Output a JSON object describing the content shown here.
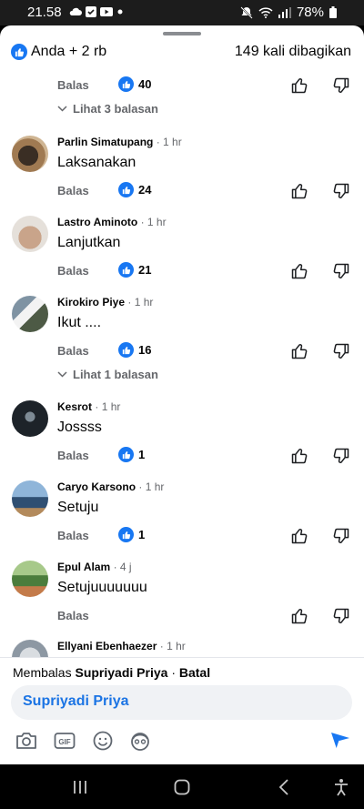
{
  "status_bar": {
    "time": "21.58",
    "battery": "78%"
  },
  "header": {
    "reactions": "Anda + 2 rb",
    "shares": "149 kali dibagikan"
  },
  "top_actions": {
    "reply_label": "Balas",
    "like_count": "40",
    "view_replies": "Lihat 3 balasan"
  },
  "comments": [
    {
      "author": "Parlin Simatupang",
      "time": "1 hr",
      "text": "Laksanakan",
      "reply_label": "Balas",
      "like_count": "24"
    },
    {
      "author": "Lastro Aminoto",
      "time": "1 hr",
      "text": "Lanjutkan",
      "reply_label": "Balas",
      "like_count": "21"
    },
    {
      "author": "Kirokiro Piye",
      "time": "1 hr",
      "text": "Ikut ....",
      "reply_label": "Balas",
      "like_count": "16",
      "view_replies": "Lihat 1 balasan"
    },
    {
      "author": "Kesrot",
      "time": "1 hr",
      "text": "Jossss",
      "reply_label": "Balas",
      "like_count": "1"
    },
    {
      "author": "Caryo Karsono",
      "time": "1 hr",
      "text": "Setuju",
      "reply_label": "Balas",
      "like_count": "1"
    },
    {
      "author": "Epul Alam",
      "time": "4 j",
      "text": "Setujuuuuuuu",
      "reply_label": "Balas",
      "like_count": ""
    },
    {
      "author": "Ellyani Ebenhaezer",
      "time": "1 hr",
      "text": ""
    }
  ],
  "reply_bar": {
    "prefix": "Membalas",
    "target": "Supriyadi Priya",
    "cancel": "Batal",
    "mention": "Supriyadi Priya"
  },
  "separator": "·",
  "icons": [
    "camera-icon",
    "gif-icon",
    "emoji-icon",
    "avatar-sticker-icon",
    "send-icon",
    "like-icon",
    "thumbs-up-icon",
    "thumbs-down-icon",
    "chevron-down-icon"
  ],
  "colors": {
    "accent": "#1877f2",
    "mention": "#1b74e4",
    "muted": "#65676b"
  }
}
